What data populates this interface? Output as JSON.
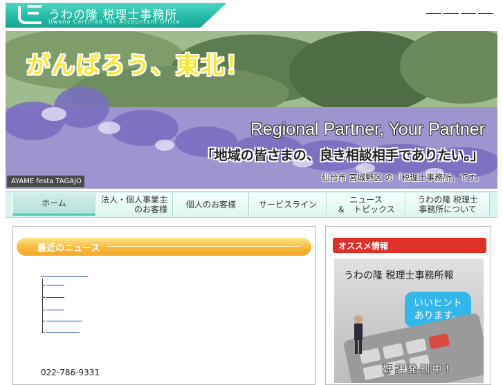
{
  "header": {
    "brand_title": "うわの隆 税理士事務所",
    "brand_subtitle": "Uwano Certified Tax Accountant Office",
    "brand_color": "#23b9a3",
    "top_links_count": 4
  },
  "hero": {
    "headline": "がんばろう、東北！",
    "slogan": "Regional Partner, Your Partner",
    "slogan_jp": "「地域の皆さまの、良き相談相手でありたい。」",
    "office_line": "仙台市 宮城野区 の「税理士事務所」です。",
    "photo_caption": "AYAME festa TAGAJO"
  },
  "nav": {
    "items": [
      {
        "label": "ホーム",
        "active": true
      },
      {
        "label_1": "法人・個人事業主",
        "label_2": "のお客様"
      },
      {
        "label": "個人のお客様"
      },
      {
        "label": "サービスライン"
      },
      {
        "label_1": "ニュース",
        "label_2": "＆　トピックス"
      },
      {
        "label_1": "うわの隆 税理士",
        "label_2": "事務所について"
      }
    ],
    "accent": "#4cc5b1"
  },
  "main": {
    "news_heading": "最近のニュース",
    "phone": "022-786-9331",
    "heading_color": "#f7b93c"
  },
  "side": {
    "heading": "オススメ情報",
    "heading_color": "#e0302a",
    "promo_title": "うわの隆 税理士事務所報",
    "promo_bubble_1": "いいヒント",
    "promo_bubble_2": "あります。",
    "promo_footer": "好評発刊中！"
  }
}
